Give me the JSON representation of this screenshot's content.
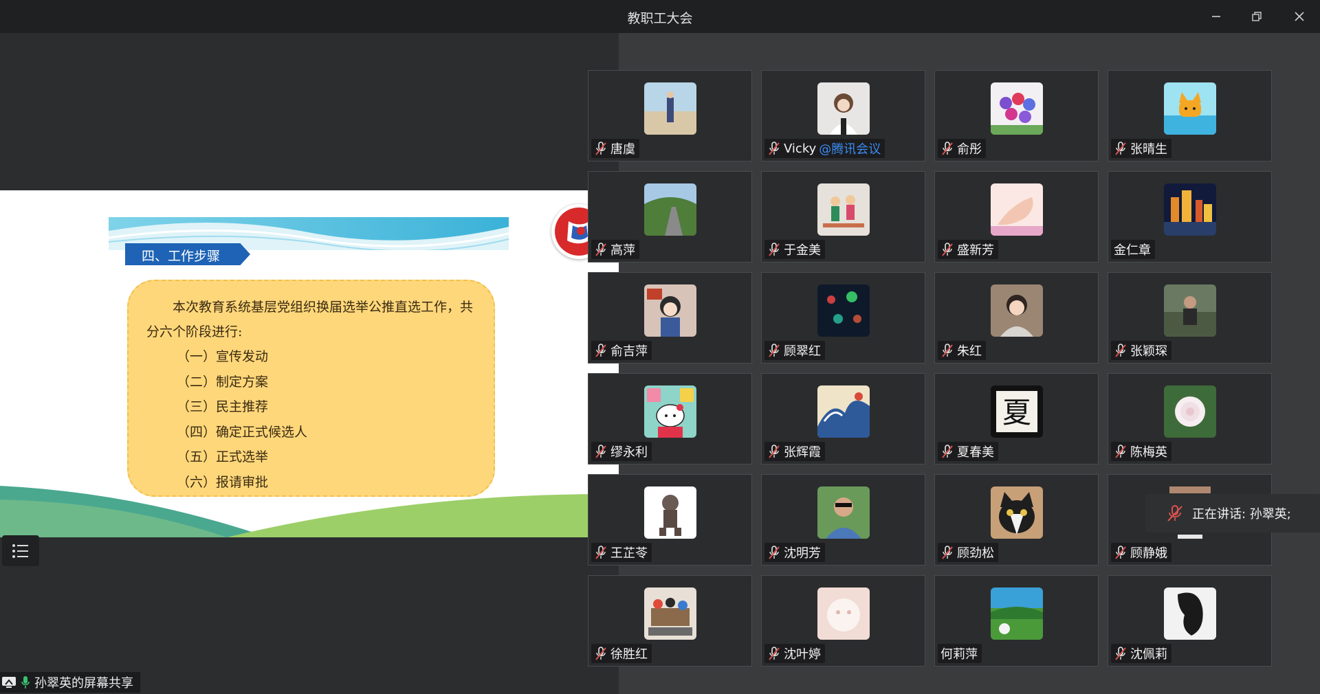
{
  "window": {
    "title": "教职工大会"
  },
  "slide": {
    "heading": "四、工作步骤",
    "intro": "本次教育系统基层党组织换届选举公推直选工作，共分六个阶段进行:",
    "steps": [
      "（一）宣传发动",
      "（二）制定方案",
      "（三）民主推荐",
      "（四）确定正式候选人",
      "（五）正式选举",
      "（六）报请审批"
    ]
  },
  "share_status": {
    "label": "孙翠英的屏幕共享"
  },
  "speaking": {
    "label": "正在讲话: 孙翠英;"
  },
  "participants": [
    {
      "name": "唐虞",
      "muted": true,
      "av": "beach"
    },
    {
      "name": "Vicky",
      "suffix": "@腾讯会议",
      "muted": true,
      "av": "girl"
    },
    {
      "name": "俞彤",
      "muted": true,
      "av": "flowers"
    },
    {
      "name": "张晴生",
      "muted": true,
      "av": "cat-sea"
    },
    {
      "name": "高萍",
      "muted": true,
      "av": "road"
    },
    {
      "name": "于金美",
      "muted": true,
      "av": "drawing"
    },
    {
      "name": "盛新芳",
      "muted": true,
      "av": "hand"
    },
    {
      "name": "金仁章",
      "muted": false,
      "av": "night-city"
    },
    {
      "name": "俞吉萍",
      "muted": true,
      "av": "anime"
    },
    {
      "name": "顾翠红",
      "muted": true,
      "av": "bokeh"
    },
    {
      "name": "朱红",
      "muted": true,
      "av": "child"
    },
    {
      "name": "张颖琛",
      "muted": true,
      "av": "person"
    },
    {
      "name": "缪永利",
      "muted": true,
      "av": "kitty"
    },
    {
      "name": "张辉霞",
      "muted": true,
      "av": "wave"
    },
    {
      "name": "夏春美",
      "muted": true,
      "av": "calligraphy"
    },
    {
      "name": "陈梅英",
      "muted": true,
      "av": "rose"
    },
    {
      "name": "王芷苓",
      "muted": true,
      "av": "ninja"
    },
    {
      "name": "沈明芳",
      "muted": true,
      "av": "man"
    },
    {
      "name": "顾劲松",
      "muted": true,
      "av": "cat"
    },
    {
      "name": "顾静娥",
      "muted": true,
      "av": "partial"
    },
    {
      "name": "徐胜红",
      "muted": true,
      "av": "kids"
    },
    {
      "name": "沈叶婷",
      "muted": true,
      "av": "fluffy"
    },
    {
      "name": "何莉萍",
      "muted": false,
      "av": "dandelion"
    },
    {
      "name": "沈佩莉",
      "muted": true,
      "av": "hair"
    }
  ]
}
